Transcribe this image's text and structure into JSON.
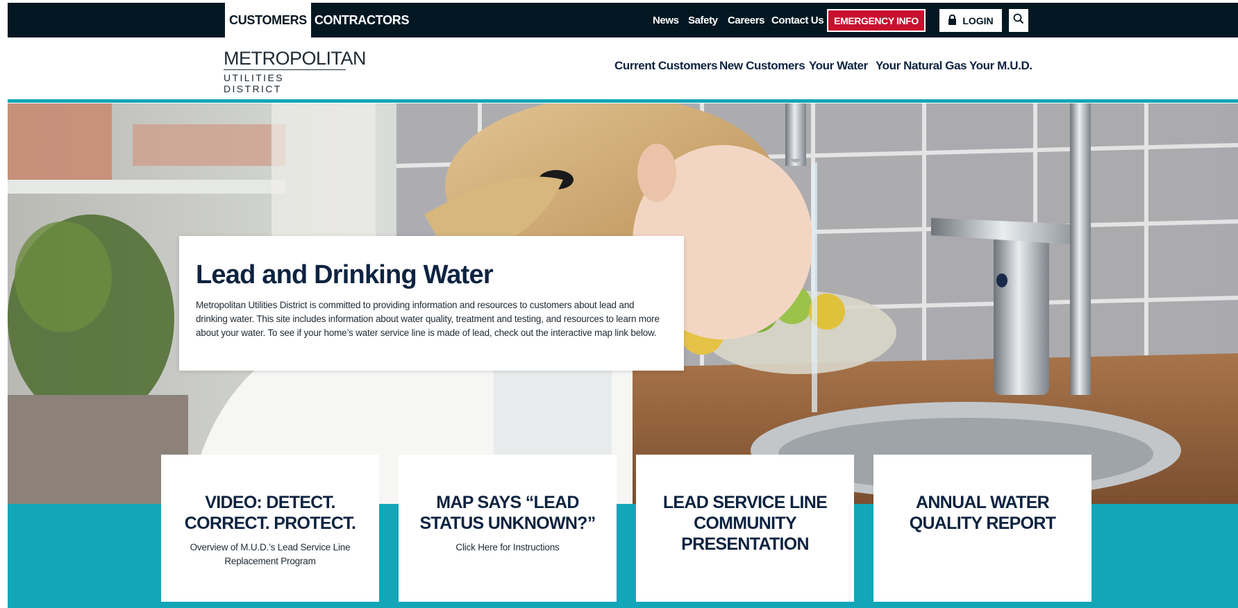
{
  "topbar": {
    "tabs": [
      {
        "label": "CUSTOMERS",
        "active": true
      },
      {
        "label": "CONTRACTORS",
        "active": false
      }
    ],
    "links": [
      "News",
      "Safety",
      "Careers",
      "Contact Us"
    ],
    "emergency_label": "EMERGENCY INFO",
    "login_label": "LOGIN",
    "search_icon": "search-icon"
  },
  "logo": {
    "top": "METROPOLITAN",
    "bottom": "UTILITIES DISTRICT"
  },
  "mainnav": {
    "items": [
      "Current Customers",
      "New Customers",
      "Your Water",
      "Your Natural Gas",
      "Your M.U.D."
    ]
  },
  "hero": {
    "title": "Lead and Drinking Water",
    "body": "Metropolitan Utilities District is committed to providing information and resources to customers about lead and drinking water. This site includes information about water quality, treatment and testing, and resources to learn more about your water. To see if your home’s water service line is made of lead, check out the interactive map link below."
  },
  "cards": [
    {
      "title": "VIDEO: DETECT. CORRECT. PROTECT.",
      "subtitle": "Overview of M.U.D.’s Lead Service Line Replacement Program"
    },
    {
      "title": "MAP SAYS “LEAD STATUS UNKNOWN?”",
      "subtitle": "Click Here for Instructions"
    },
    {
      "title": "LEAD SERVICE LINE COMMUNITY PRESENTATION",
      "subtitle": ""
    },
    {
      "title": "ANNUAL WATER QUALITY REPORT",
      "subtitle": ""
    }
  ],
  "colors": {
    "topbar_bg": "#031722",
    "navy": "#0d2340",
    "teal": "#12a6b8",
    "emergency_red": "#c8102e"
  }
}
